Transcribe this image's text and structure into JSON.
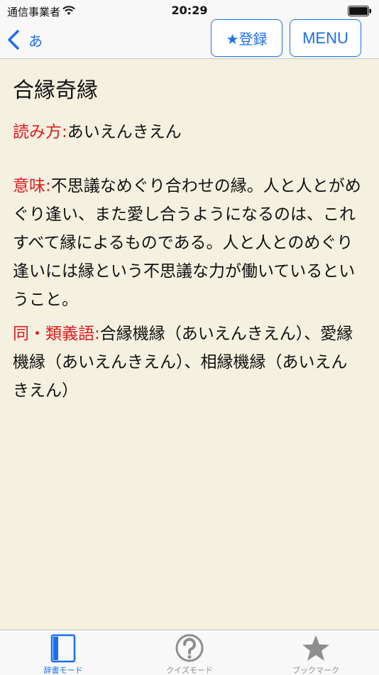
{
  "status_bar": {
    "carrier": "通信事業者",
    "time": "20:29"
  },
  "nav": {
    "back_label": "あ",
    "register_label": "★登録",
    "menu_label": "MENU"
  },
  "entry": {
    "title": "合縁奇縁",
    "reading_label": "読み方:",
    "reading": "あいえんきえん",
    "meaning_label": "意味:",
    "meaning": "不思議なめぐり合わせの縁。人と人とがめぐり逢い、また愛し合うようになるのは、これすべて縁によるものである。人と人とのめぐり逢いには縁という不思議な力が働いているということ。",
    "synonyms_label": "同・類義語:",
    "synonyms": "合縁機縁（あいえんきえん）、愛縁機縁（あいえんきえん）、相縁機縁（あいえんきえん）"
  },
  "tabs": [
    {
      "label": "辞書モード",
      "icon": "book-icon",
      "active": true
    },
    {
      "label": "クイズモード",
      "icon": "question-circle-icon",
      "active": false
    },
    {
      "label": "ブックマーク",
      "icon": "star-icon",
      "active": false
    }
  ],
  "colors": {
    "accent": "#1a6ff0",
    "label_red": "#e1191f",
    "background": "#f4f1e0"
  }
}
